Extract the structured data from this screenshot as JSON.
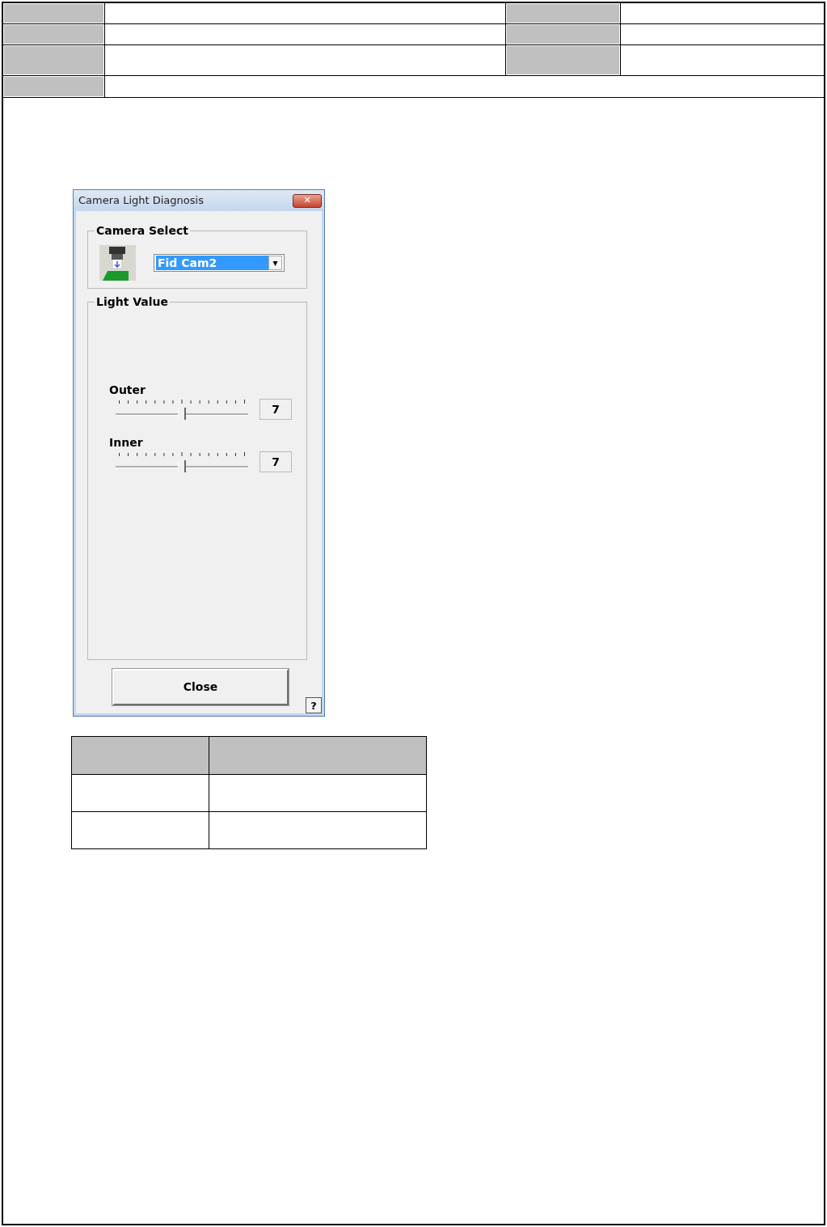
{
  "dialog": {
    "title": "Camera Light Diagnosis",
    "close_glyph": "✕"
  },
  "camera_select": {
    "legend": "Camera Select",
    "value": "Fid Cam2",
    "arrow": "▾"
  },
  "light_value": {
    "legend": "Light Value",
    "sliders": [
      {
        "label": "Outer",
        "level": 0.5,
        "reading": "7"
      },
      {
        "label": "Inner",
        "level": 0.5,
        "reading": "7"
      }
    ]
  },
  "buttons": {
    "close": "Close",
    "help": "?"
  }
}
